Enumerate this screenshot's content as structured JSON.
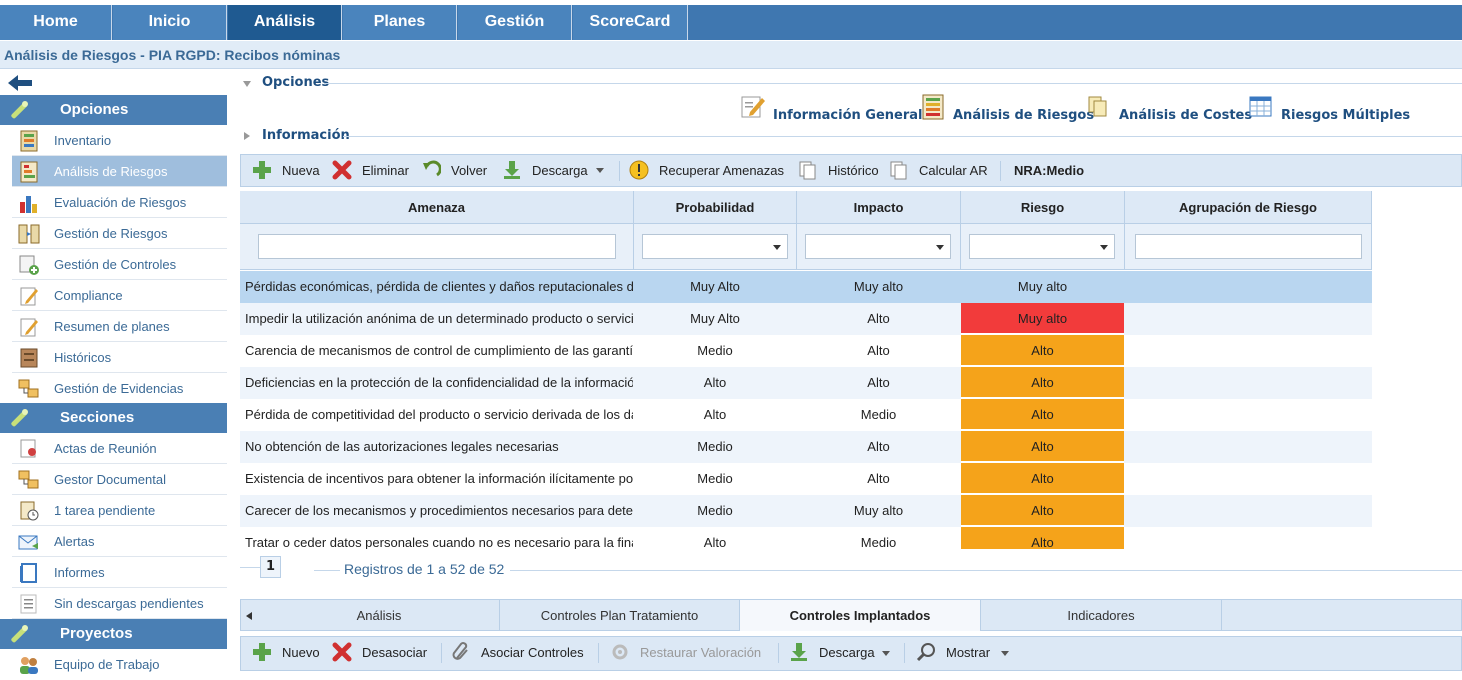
{
  "topnav": {
    "tabs": [
      {
        "label": "Home"
      },
      {
        "label": "Inicio"
      },
      {
        "label": "Análisis"
      },
      {
        "label": "Planes"
      },
      {
        "label": "Gestión"
      },
      {
        "label": "ScoreCard"
      }
    ],
    "active_index": 2
  },
  "breadcrumb": "Análisis de Riesgos  - PIA RGPD: Recibos nóminas",
  "sidebar": {
    "sections": [
      {
        "title": "Opciones",
        "items": [
          {
            "label": "Inventario",
            "icon": "inventory-icon"
          },
          {
            "label": "Análisis de Riesgos",
            "icon": "risk-analysis-icon"
          },
          {
            "label": "Evaluación de Riesgos",
            "icon": "bar-chart-icon"
          },
          {
            "label": "Gestión de Riesgos",
            "icon": "risk-management-icon"
          },
          {
            "label": "Gestión de Controles",
            "icon": "controls-icon"
          },
          {
            "label": "Compliance",
            "icon": "pencil-icon"
          },
          {
            "label": "Resumen de planes",
            "icon": "pencil-icon"
          },
          {
            "label": "Históricos",
            "icon": "archive-icon"
          },
          {
            "label": "Gestión de Evidencias",
            "icon": "evidence-icon"
          }
        ]
      },
      {
        "title": "Secciones",
        "items": [
          {
            "label": "Actas de Reunión",
            "icon": "meeting-icon"
          },
          {
            "label": "Gestor Documental",
            "icon": "documents-icon"
          },
          {
            "label": "1 tarea pendiente",
            "icon": "task-icon"
          },
          {
            "label": "Alertas",
            "icon": "mail-icon"
          },
          {
            "label": "Informes",
            "icon": "report-icon"
          },
          {
            "label": "Sin descargas pendientes",
            "icon": "list-icon"
          }
        ]
      },
      {
        "title": "Proyectos",
        "items": [
          {
            "label": "Equipo de Trabajo",
            "icon": "team-icon"
          }
        ]
      }
    ],
    "active_item": "Análisis de Riesgos"
  },
  "panels": {
    "options_label": "Opciones",
    "info_label": "Información"
  },
  "quick_actions": [
    {
      "label": "Información General",
      "icon": "edit-document-icon"
    },
    {
      "label": "Análisis de Riesgos",
      "icon": "risk-analysis-icon"
    },
    {
      "label": "Análisis de Costes",
      "icon": "cost-icon"
    },
    {
      "label": "Riesgos Múltiples",
      "icon": "table-icon"
    }
  ],
  "toolbar": {
    "nueva": "Nueva",
    "eliminar": "Eliminar",
    "volver": "Volver",
    "descarga": "Descarga",
    "recuperar": "Recuperar Amenazas",
    "historico": "Histórico",
    "calcular": "Calcular AR",
    "nra": "NRA:Medio"
  },
  "grid": {
    "columns": [
      "Amenaza",
      "Probabilidad",
      "Impacto",
      "Riesgo",
      "Agrupación de Riesgo"
    ],
    "rows": [
      {
        "amenaza": "Pérdidas económicas, pérdida de clientes y daños reputacionales derivados",
        "probabilidad": "Muy Alto",
        "impacto": "Muy alto",
        "riesgo": "Muy alto",
        "level": "none"
      },
      {
        "amenaza": "Impedir la utilización anónima de un determinado producto o servicio",
        "probabilidad": "Muy Alto",
        "impacto": "Alto",
        "riesgo": "Muy alto",
        "level": "red"
      },
      {
        "amenaza": "Carencia de mecanismos de control de cumplimiento de las garantías",
        "probabilidad": "Medio",
        "impacto": "Alto",
        "riesgo": "Alto",
        "level": "orange"
      },
      {
        "amenaza": "Deficiencias en la protección de la confidencialidad de la información",
        "probabilidad": "Alto",
        "impacto": "Alto",
        "riesgo": "Alto",
        "level": "orange"
      },
      {
        "amenaza": "Pérdida de competitividad del producto o servicio derivada de los datos",
        "probabilidad": "Alto",
        "impacto": "Medio",
        "riesgo": "Alto",
        "level": "orange"
      },
      {
        "amenaza": "No obtención de las autorizaciones legales necesarias",
        "probabilidad": "Medio",
        "impacto": "Alto",
        "riesgo": "Alto",
        "level": "orange"
      },
      {
        "amenaza": "Existencia de incentivos para obtener la información ilícitamente por",
        "probabilidad": "Medio",
        "impacto": "Alto",
        "riesgo": "Alto",
        "level": "orange"
      },
      {
        "amenaza": "Carecer de los mecanismos y procedimientos necesarios para detectar",
        "probabilidad": "Medio",
        "impacto": "Muy alto",
        "riesgo": "Alto",
        "level": "orange"
      },
      {
        "amenaza": "Tratar o ceder datos personales cuando no es necesario para la finalidad",
        "probabilidad": "Alto",
        "impacto": "Medio",
        "riesgo": "Alto",
        "level": "orange"
      }
    ]
  },
  "pager": {
    "page": "1",
    "info": "Registros de 1 a 52 de 52"
  },
  "subtabs": [
    {
      "label": "Análisis"
    },
    {
      "label": "Controles Plan Tratamiento"
    },
    {
      "label": "Controles Implantados"
    },
    {
      "label": "Indicadores"
    }
  ],
  "subtoolbar": {
    "nuevo": "Nuevo",
    "desasociar": "Desasociar",
    "asociar": "Asociar Controles",
    "restaurar": "Restaurar Valoración",
    "descarga": "Descarga",
    "mostrar": "Mostrar"
  },
  "colors": {
    "nav": "#4a84bd",
    "nav_active": "#1f5a91",
    "risk_very_high": "#f23b3b",
    "risk_high": "#f5a31a"
  }
}
